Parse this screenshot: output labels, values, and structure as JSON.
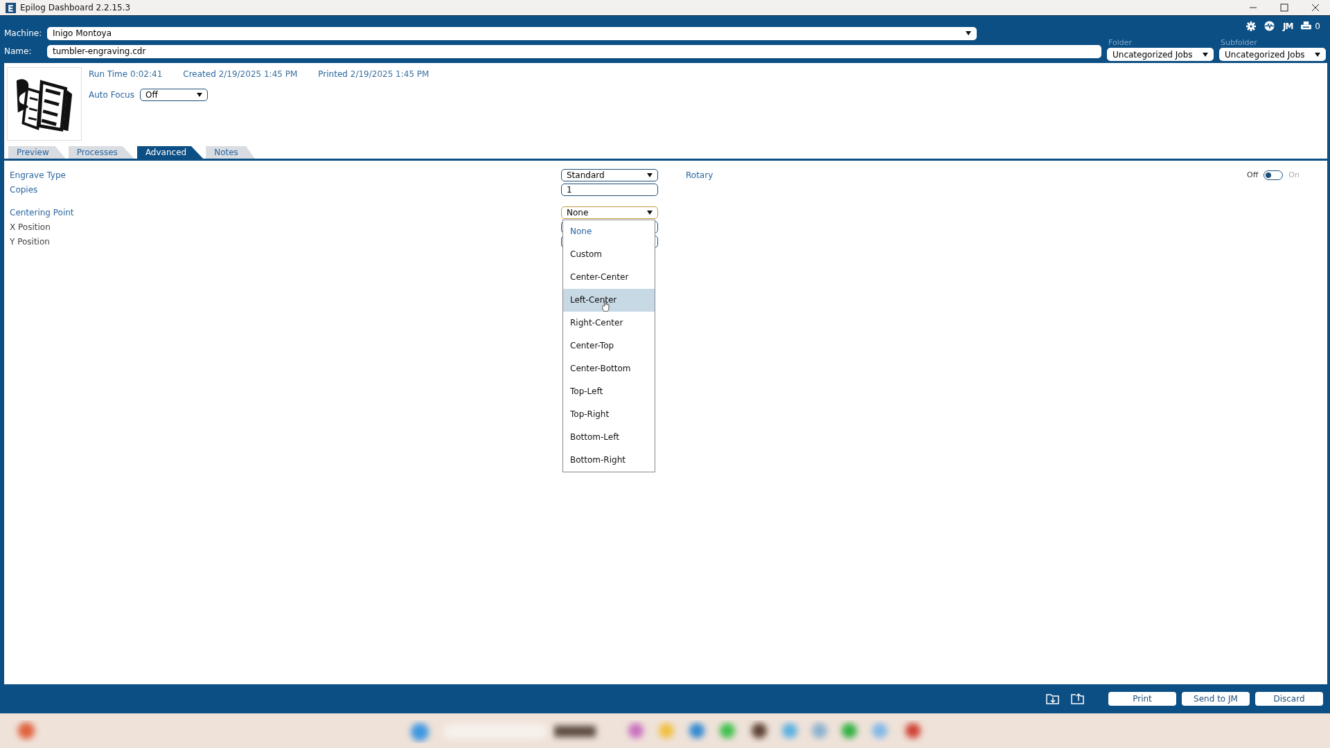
{
  "window": {
    "title": "Epilog Dashboard 2.2.15.3"
  },
  "machine": {
    "label": "Machine:",
    "value": "Inigo Montoya"
  },
  "name": {
    "label": "Name:",
    "value": "tumbler-engraving.cdr"
  },
  "folder": {
    "label": "Folder",
    "value": "Uncategorized Jobs"
  },
  "subfolder": {
    "label": "Subfolder",
    "value": "Uncategorized Jobs"
  },
  "header_tools": {
    "jm": "JM",
    "print_count": "0"
  },
  "info": [
    {
      "label": "Run Time",
      "value": "0:02:41"
    },
    {
      "label": "Created",
      "value": "2/19/2025 1:45 PM"
    },
    {
      "label": "Printed",
      "value": "2/19/2025 1:45 PM"
    }
  ],
  "auto_focus": {
    "label": "Auto Focus",
    "value": "Off"
  },
  "tabs": [
    {
      "label": "Preview",
      "selected": false
    },
    {
      "label": "Processes",
      "selected": false
    },
    {
      "label": "Advanced",
      "selected": true
    },
    {
      "label": "Notes",
      "selected": false
    }
  ],
  "settings": [
    {
      "kind": "select",
      "label": "Engrave Type",
      "value": "Standard",
      "emphasis": true,
      "open": false
    },
    {
      "kind": "input",
      "label": "Copies",
      "value": "1",
      "emphasis": true
    },
    {
      "kind": "select",
      "label": "Centering Point",
      "value": "None",
      "emphasis": true,
      "open": true
    },
    {
      "kind": "input",
      "label": "X Position",
      "emphasis": false
    },
    {
      "kind": "input",
      "label": "Y Position",
      "emphasis": false
    }
  ],
  "rotary": {
    "label": "Rotary",
    "off_label": "Off",
    "on_label": "On",
    "on": false
  },
  "centering_options": [
    {
      "label": "None",
      "selected": true,
      "highlighted": false
    },
    {
      "label": "Custom",
      "selected": false,
      "highlighted": false
    },
    {
      "label": "Center-Center",
      "selected": false,
      "highlighted": false
    },
    {
      "label": "Left-Center",
      "selected": false,
      "highlighted": true
    },
    {
      "label": "Right-Center",
      "selected": false,
      "highlighted": false
    },
    {
      "label": "Center-Top",
      "selected": false,
      "highlighted": false
    },
    {
      "label": "Center-Bottom",
      "selected": false,
      "highlighted": false
    },
    {
      "label": "Top-Left",
      "selected": false,
      "highlighted": false
    },
    {
      "label": "Top-Right",
      "selected": false,
      "highlighted": false
    },
    {
      "label": "Bottom-Left",
      "selected": false,
      "highlighted": false
    },
    {
      "label": "Bottom-Right",
      "selected": false,
      "highlighted": false
    }
  ],
  "footer_buttons": [
    "Print",
    "Send to JM",
    "Discard"
  ]
}
